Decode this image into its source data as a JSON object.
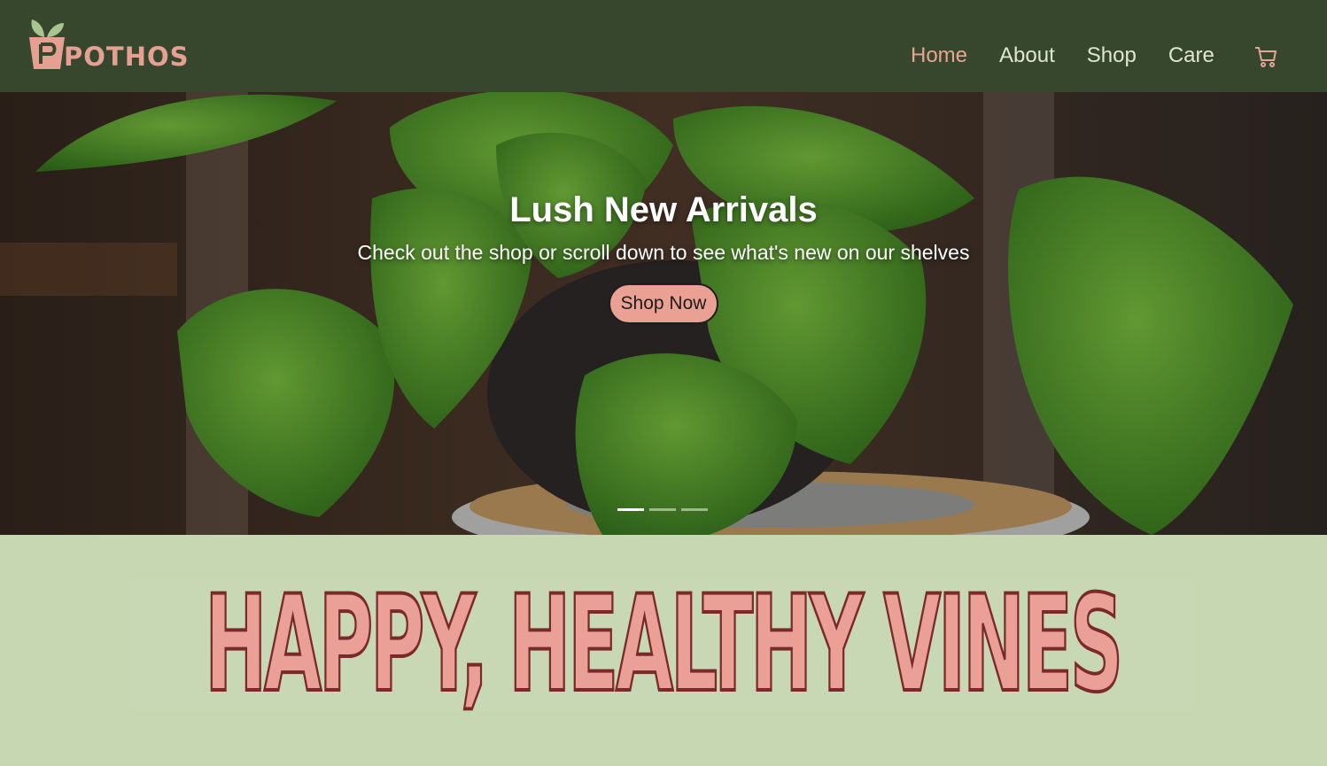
{
  "brand": {
    "name": "POTHOS",
    "logo_icon": "plant-pot-icon",
    "color": "#e6a092"
  },
  "nav": {
    "items": [
      {
        "label": "Home",
        "active": true
      },
      {
        "label": "About",
        "active": false
      },
      {
        "label": "Shop",
        "active": false
      },
      {
        "label": "Care",
        "active": false
      }
    ],
    "cart_icon": "shopping-cart-icon"
  },
  "hero": {
    "title": "Lush New Arrivals",
    "subtitle": "Check out the shop or scroll down to see what's new on our shelves",
    "button_label": "Shop Now",
    "slides": {
      "count": 3,
      "active_index": 0
    },
    "image": "monstera-plant-in-black-pot"
  },
  "banner": {
    "text": "HAPPY, HEALTHY VINES"
  },
  "colors": {
    "header_bg": "#37472e",
    "accent_pink": "#eba094",
    "nav_text": "#dfe6cf",
    "page_bg": "#c6d7b1",
    "banner_outline": "#7a2a2a"
  }
}
